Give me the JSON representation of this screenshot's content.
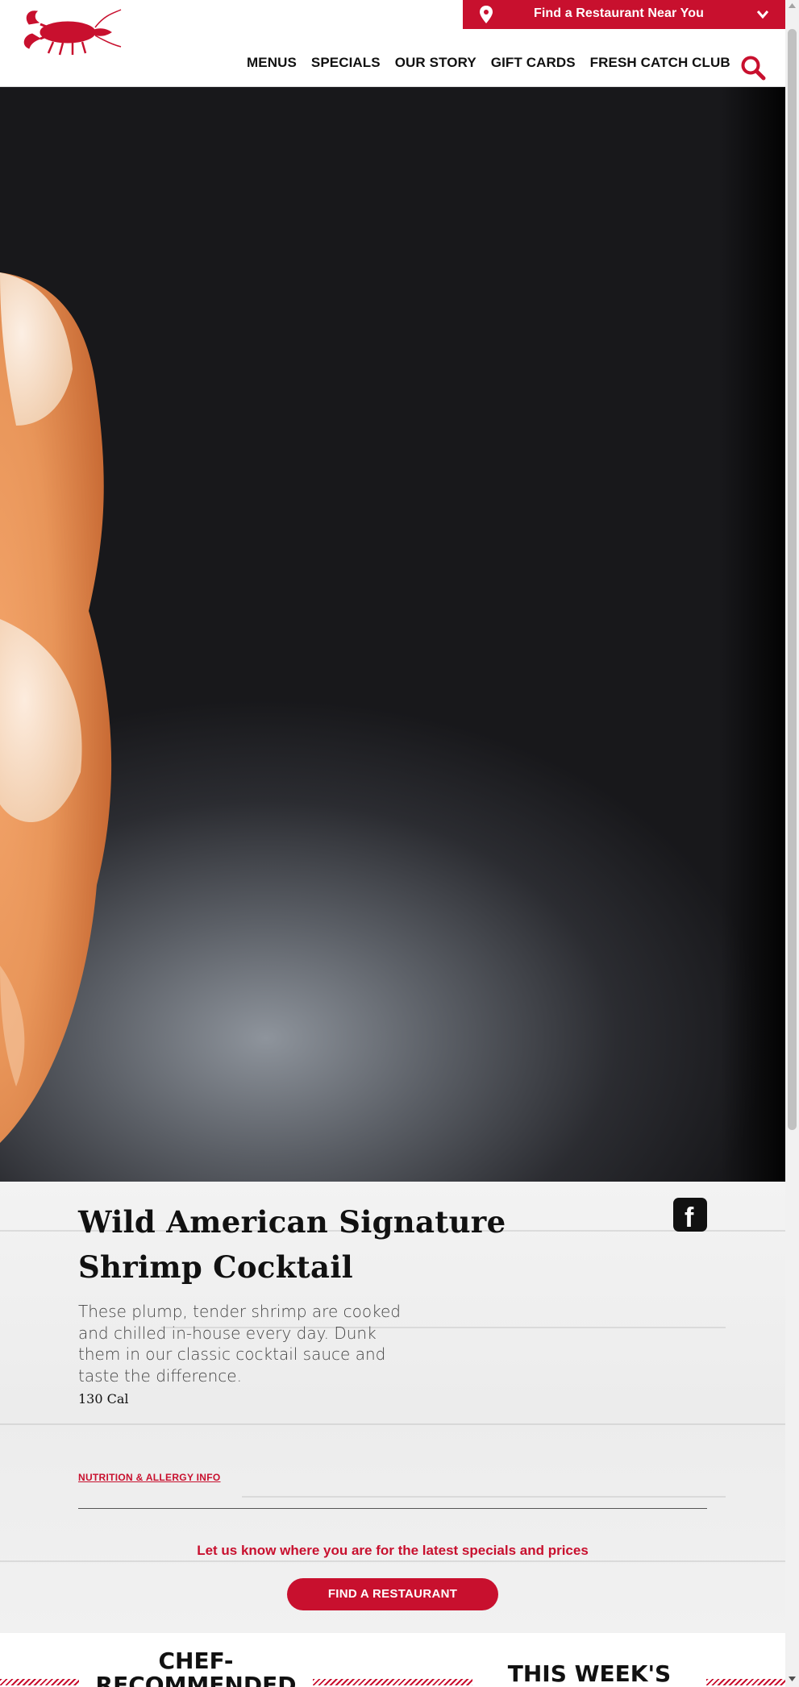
{
  "header": {
    "find_restaurant_label": "Find a Restaurant Near You",
    "nav": [
      {
        "label": "MENUS"
      },
      {
        "label": "SPECIALS"
      },
      {
        "label": "OUR STORY"
      },
      {
        "label": "GIFT CARDS"
      },
      {
        "label": "FRESH CATCH CLUB"
      }
    ],
    "icons": {
      "pin": "location-pin-icon",
      "chevron": "chevron-down-icon",
      "search": "search-icon",
      "logo": "lobster-logo"
    }
  },
  "product": {
    "title": "Wild American Signature Shrimp Cocktail",
    "description": "These plump, tender shrimp are cooked and chilled in-house every day. Dunk them in our classic cocktail sauce and taste the difference.",
    "calories": "130 Cal",
    "nutrition_link": "NUTRITION & ALLERGY INFO",
    "share_icon": "facebook-icon"
  },
  "locate": {
    "prompt": "Let us know where you are for the latest specials and prices",
    "button_label": "FIND A RESTAURANT"
  },
  "sections": {
    "chef_recommended": "CHEF-\nRECOMMENDED",
    "this_week": "THIS WEEK'S"
  },
  "colors": {
    "brand_red": "#c8102e",
    "text_dark": "#111111",
    "panel_bg": "#f0f0f0"
  }
}
